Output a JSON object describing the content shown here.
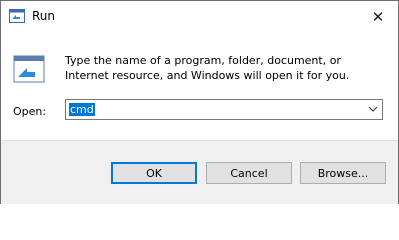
{
  "window": {
    "title": "Run",
    "close_glyph": "✕"
  },
  "description": "Type the name of a program, folder, document, or Internet resource, and Windows will open it for you.",
  "open": {
    "label": "Open:",
    "value": "cmd"
  },
  "buttons": {
    "ok": "OK",
    "cancel": "Cancel",
    "browse": "Browse..."
  },
  "colors": {
    "accent": "#0078d7",
    "footer_bg": "#f0f0f0",
    "button_bg": "#e1e1e1"
  },
  "icons": {
    "app": "run-icon",
    "close": "close-icon",
    "dropdown": "chevron-down-icon"
  }
}
